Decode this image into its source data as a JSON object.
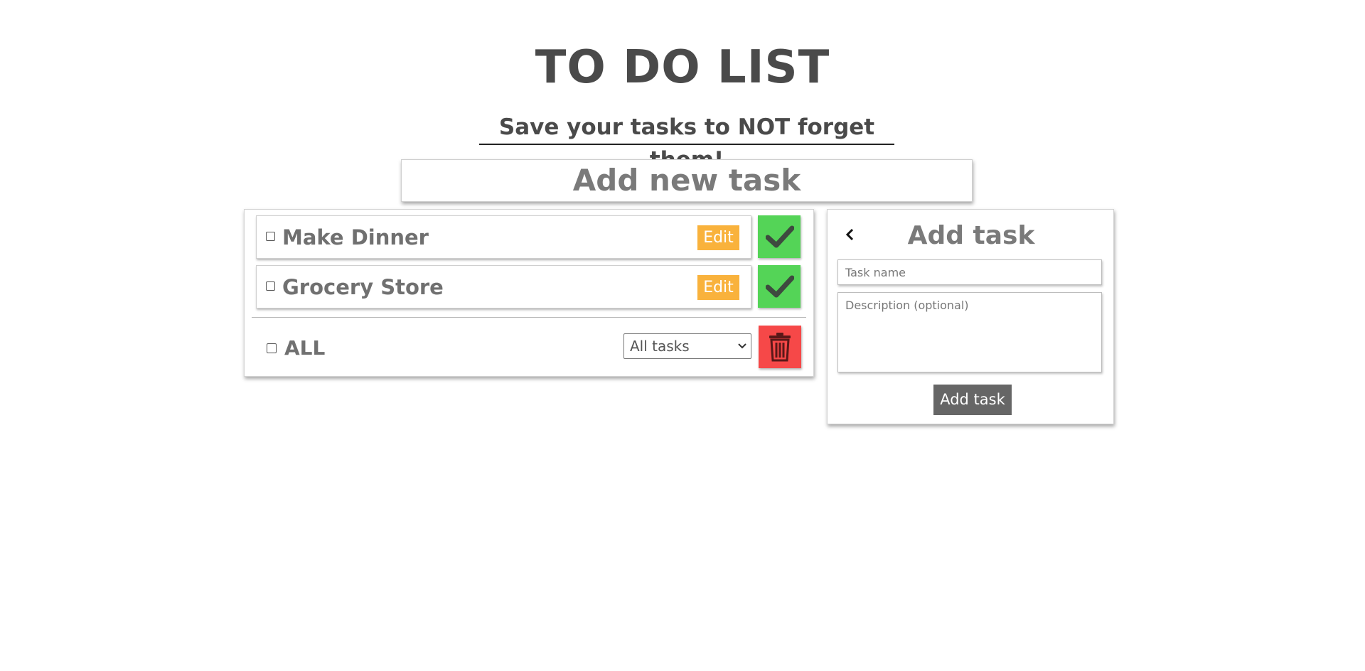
{
  "header": {
    "title": "TO DO LIST",
    "subtitle": "Save your tasks to NOT forget them!"
  },
  "add_new": {
    "label": "Add new task"
  },
  "tasks": [
    {
      "name": "Make Dinner",
      "checked": false,
      "edit_label": "Edit"
    },
    {
      "name": "Grocery Store",
      "checked": false,
      "edit_label": "Edit"
    }
  ],
  "list_footer": {
    "select_all_label": "ALL",
    "filter_selected": "All tasks"
  },
  "form": {
    "title": "Add task",
    "task_name_placeholder": "Task name",
    "description_placeholder": "Description (optional)",
    "submit_label": "Add task"
  },
  "colors": {
    "edit": "#f9b23c",
    "done": "#54d457",
    "delete": "#f64848",
    "submit": "#666666",
    "text": "#4a4a4a"
  },
  "icons": {
    "done": "check-icon",
    "delete": "trash-icon",
    "back": "chevron-left-icon",
    "select": "chevron-down-icon"
  }
}
